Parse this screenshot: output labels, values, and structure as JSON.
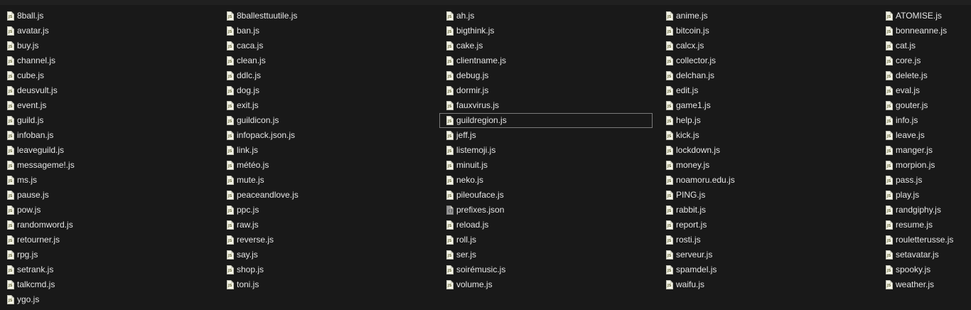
{
  "window": {
    "title": ""
  },
  "focused_file": "guildregion.js",
  "columns": [
    {
      "files": [
        {
          "name": "8ball.js",
          "icon": "js-file-icon"
        },
        {
          "name": "avatar.js",
          "icon": "js-file-icon"
        },
        {
          "name": "buy.js",
          "icon": "js-file-icon"
        },
        {
          "name": "channel.js",
          "icon": "js-file-icon"
        },
        {
          "name": "cube.js",
          "icon": "js-file-icon"
        },
        {
          "name": "deusvult.js",
          "icon": "js-file-icon"
        },
        {
          "name": "event.js",
          "icon": "js-file-icon"
        },
        {
          "name": "guild.js",
          "icon": "js-file-icon"
        },
        {
          "name": "infoban.js",
          "icon": "js-file-icon"
        },
        {
          "name": "leaveguild.js",
          "icon": "js-file-icon"
        },
        {
          "name": "messageme!.js",
          "icon": "js-file-icon"
        },
        {
          "name": "ms.js",
          "icon": "js-file-icon"
        },
        {
          "name": "pause.js",
          "icon": "js-file-icon"
        },
        {
          "name": "pow.js",
          "icon": "js-file-icon"
        },
        {
          "name": "randomword.js",
          "icon": "js-file-icon"
        },
        {
          "name": "retourner.js",
          "icon": "js-file-icon"
        },
        {
          "name": "rpg.js",
          "icon": "js-file-icon"
        },
        {
          "name": "setrank.js",
          "icon": "js-file-icon"
        },
        {
          "name": "talkcmd.js",
          "icon": "js-file-icon"
        },
        {
          "name": "ygo.js",
          "icon": "js-file-icon"
        }
      ]
    },
    {
      "files": [
        {
          "name": "8ballesttuutile.js",
          "icon": "js-file-icon"
        },
        {
          "name": "ban.js",
          "icon": "js-file-icon"
        },
        {
          "name": "caca.js",
          "icon": "js-file-icon"
        },
        {
          "name": "clean.js",
          "icon": "js-file-icon"
        },
        {
          "name": "ddlc.js",
          "icon": "js-file-icon"
        },
        {
          "name": "dog.js",
          "icon": "js-file-icon"
        },
        {
          "name": "exit.js",
          "icon": "js-file-icon"
        },
        {
          "name": "guildicon.js",
          "icon": "js-file-icon"
        },
        {
          "name": "infopack.json.js",
          "icon": "js-file-icon"
        },
        {
          "name": "link.js",
          "icon": "js-file-icon"
        },
        {
          "name": "météo.js",
          "icon": "js-file-icon"
        },
        {
          "name": "mute.js",
          "icon": "js-file-icon"
        },
        {
          "name": "peaceandlove.js",
          "icon": "js-file-icon"
        },
        {
          "name": "ppc.js",
          "icon": "js-file-icon"
        },
        {
          "name": "raw.js",
          "icon": "js-file-icon"
        },
        {
          "name": "reverse.js",
          "icon": "js-file-icon"
        },
        {
          "name": "say.js",
          "icon": "js-file-icon"
        },
        {
          "name": "shop.js",
          "icon": "js-file-icon"
        },
        {
          "name": "toni.js",
          "icon": "js-file-icon"
        }
      ]
    },
    {
      "files": [
        {
          "name": "ah.js",
          "icon": "js-file-icon"
        },
        {
          "name": "bigthink.js",
          "icon": "js-file-icon"
        },
        {
          "name": "cake.js",
          "icon": "js-file-icon"
        },
        {
          "name": "clientname.js",
          "icon": "js-file-icon"
        },
        {
          "name": "debug.js",
          "icon": "js-file-icon"
        },
        {
          "name": "dormir.js",
          "icon": "js-file-icon"
        },
        {
          "name": "fauxvirus.js",
          "icon": "js-file-icon"
        },
        {
          "name": "guildregion.js",
          "icon": "js-file-icon"
        },
        {
          "name": "jeff.js",
          "icon": "js-file-icon"
        },
        {
          "name": "listemoji.js",
          "icon": "js-file-icon"
        },
        {
          "name": "minuit.js",
          "icon": "js-file-icon"
        },
        {
          "name": "neko.js",
          "icon": "js-file-icon"
        },
        {
          "name": "pileouface.js",
          "icon": "js-file-icon"
        },
        {
          "name": "prefixes.json",
          "icon": "json-file-icon"
        },
        {
          "name": "reload.js",
          "icon": "js-file-icon"
        },
        {
          "name": "roll.js",
          "icon": "js-file-icon"
        },
        {
          "name": "ser.js",
          "icon": "js-file-icon"
        },
        {
          "name": "soirémusic.js",
          "icon": "js-file-icon"
        },
        {
          "name": "volume.js",
          "icon": "js-file-icon"
        }
      ]
    },
    {
      "files": [
        {
          "name": "anime.js",
          "icon": "js-file-icon"
        },
        {
          "name": "bitcoin.js",
          "icon": "js-file-icon"
        },
        {
          "name": "calcx.js",
          "icon": "js-file-icon"
        },
        {
          "name": "collector.js",
          "icon": "js-file-icon"
        },
        {
          "name": "delchan.js",
          "icon": "js-file-icon"
        },
        {
          "name": "edit.js",
          "icon": "js-file-icon"
        },
        {
          "name": "game1.js",
          "icon": "js-file-icon"
        },
        {
          "name": "help.js",
          "icon": "js-file-icon"
        },
        {
          "name": "kick.js",
          "icon": "js-file-icon"
        },
        {
          "name": "lockdown.js",
          "icon": "js-file-icon"
        },
        {
          "name": "money.js",
          "icon": "js-file-icon"
        },
        {
          "name": "noamoru.edu.js",
          "icon": "js-file-icon"
        },
        {
          "name": "PING.js",
          "icon": "js-file-icon"
        },
        {
          "name": "rabbit.js",
          "icon": "js-file-icon"
        },
        {
          "name": "report.js",
          "icon": "js-file-icon"
        },
        {
          "name": "rosti.js",
          "icon": "js-file-icon"
        },
        {
          "name": "serveur.js",
          "icon": "js-file-icon"
        },
        {
          "name": "spamdel.js",
          "icon": "js-file-icon"
        },
        {
          "name": "waifu.js",
          "icon": "js-file-icon"
        }
      ]
    },
    {
      "files": [
        {
          "name": "ATOMISE.js",
          "icon": "js-file-icon"
        },
        {
          "name": "bonneanne.js",
          "icon": "js-file-icon"
        },
        {
          "name": "cat.js",
          "icon": "js-file-icon"
        },
        {
          "name": "core.js",
          "icon": "js-file-icon"
        },
        {
          "name": "delete.js",
          "icon": "js-file-icon"
        },
        {
          "name": "eval.js",
          "icon": "js-file-icon"
        },
        {
          "name": "gouter.js",
          "icon": "js-file-icon"
        },
        {
          "name": "info.js",
          "icon": "js-file-icon"
        },
        {
          "name": "leave.js",
          "icon": "js-file-icon"
        },
        {
          "name": "manger.js",
          "icon": "js-file-icon"
        },
        {
          "name": "morpion.js",
          "icon": "js-file-icon"
        },
        {
          "name": "pass.js",
          "icon": "js-file-icon"
        },
        {
          "name": "play.js",
          "icon": "js-file-icon"
        },
        {
          "name": "randgiphy.js",
          "icon": "js-file-icon"
        },
        {
          "name": "resume.js",
          "icon": "js-file-icon"
        },
        {
          "name": "rouletterusse.js",
          "icon": "js-file-icon"
        },
        {
          "name": "setavatar.js",
          "icon": "js-file-icon"
        },
        {
          "name": "spooky.js",
          "icon": "js-file-icon"
        },
        {
          "name": "weather.js",
          "icon": "js-file-icon"
        }
      ]
    }
  ]
}
